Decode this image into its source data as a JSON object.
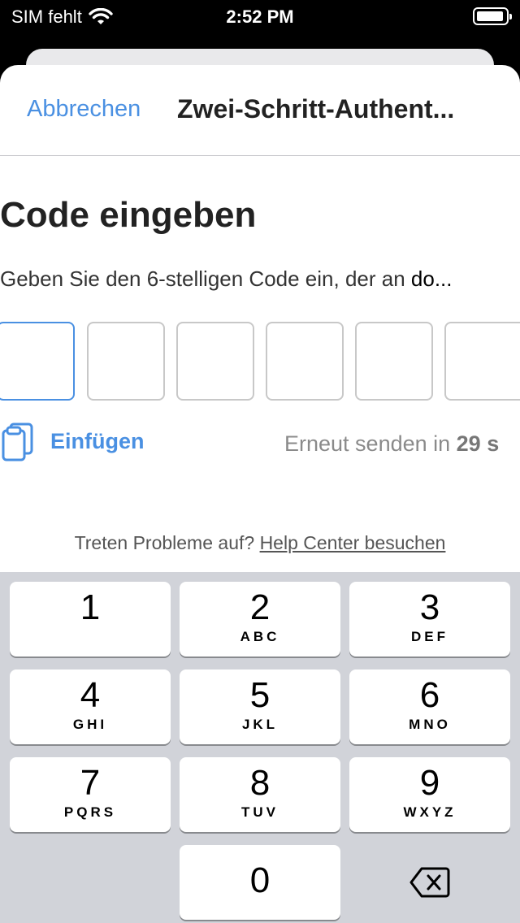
{
  "status_bar": {
    "carrier": "SIM fehlt",
    "time": "2:52 PM"
  },
  "nav": {
    "cancel_label": "Abbrechen",
    "title": "Zwei-Schritt-Authent..."
  },
  "main": {
    "heading": "Code eingeben",
    "subtitle_prefix": "Geben Sie den 6-stelligen Code ein, der an ",
    "subtitle_target": "do...",
    "code_boxes": [
      "",
      "",
      "",
      "",
      "",
      ""
    ],
    "paste_label": "Einfügen",
    "resend_prefix": "Erneut senden in ",
    "resend_countdown": "29 s",
    "help_prefix": "Treten Probleme auf? ",
    "help_link": "Help Center besuchen"
  },
  "keypad": {
    "keys": [
      {
        "digit": "1",
        "letters": ""
      },
      {
        "digit": "2",
        "letters": "ABC"
      },
      {
        "digit": "3",
        "letters": "DEF"
      },
      {
        "digit": "4",
        "letters": "GHI"
      },
      {
        "digit": "5",
        "letters": "JKL"
      },
      {
        "digit": "6",
        "letters": "MNO"
      },
      {
        "digit": "7",
        "letters": "PQRS"
      },
      {
        "digit": "8",
        "letters": "TUV"
      },
      {
        "digit": "9",
        "letters": "WXYZ"
      },
      {
        "digit": "0",
        "letters": ""
      }
    ],
    "delete_icon": "backspace-icon"
  },
  "colors": {
    "accent": "#4a90e2",
    "keypad_bg": "#d1d3d9"
  }
}
